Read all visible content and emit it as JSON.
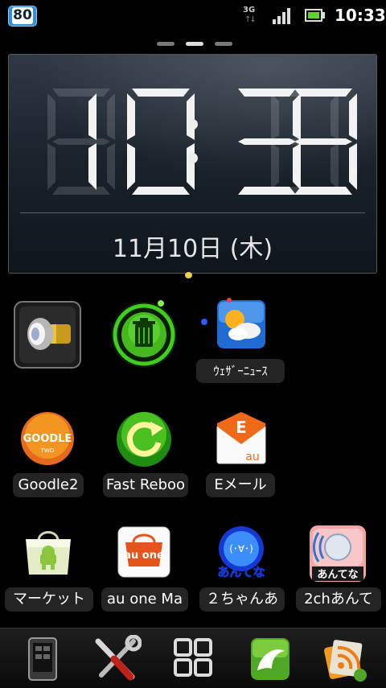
{
  "status_bar": {
    "notification_badge": "80",
    "network": "3G",
    "time": "10:33",
    "signal_bars": 4,
    "battery_level": 0.8,
    "battery_color": "#5ed52a"
  },
  "home": {
    "page_count": 3,
    "active_page": 2
  },
  "clock_widget": {
    "digits": [
      "1",
      "0",
      "3",
      "3"
    ],
    "date": "11月10日 (木)"
  },
  "apps": [
    {
      "name": "flashlight",
      "label": "",
      "icon": "flashlight-icon"
    },
    {
      "name": "task-killer",
      "label": "",
      "icon": "trash-can-icon"
    },
    {
      "name": "weather-news",
      "label": "ｳｪｻﾞｰﾆｭｰｽ",
      "icon": "weather-icon"
    },
    {
      "name": "goodle2",
      "label": "Goodle2",
      "icon": "goodle-logo-icon"
    },
    {
      "name": "fast-reboot",
      "label": "Fast Reboo",
      "icon": "refresh-icon"
    },
    {
      "name": "e-mail",
      "label": "Eメール",
      "icon": "email-icon"
    },
    {
      "name": "market",
      "label": "マーケット",
      "icon": "market-bag-icon"
    },
    {
      "name": "au-one-market",
      "label": "au one Ma",
      "icon": "au-one-icon"
    },
    {
      "name": "2ch-anntena",
      "label": "２ちゃんあ",
      "icon": "anntena-icon"
    },
    {
      "name": "2ch-anntena-2",
      "label": "2chあんて",
      "icon": "anntena-red-icon"
    }
  ],
  "icon_text": {
    "goodle": "GOODLE",
    "goodle_sub": "TWO",
    "email_letter": "E",
    "email_sub": "au",
    "au_one": "au one",
    "anntena_face": "(･∀･)",
    "anntena_label": "あんてな"
  },
  "dock": [
    {
      "name": "phone",
      "icon": "phone-device-icon"
    },
    {
      "name": "settings",
      "icon": "tools-icon"
    },
    {
      "name": "app-drawer",
      "icon": "grid-icon"
    },
    {
      "name": "dolphin-browser",
      "icon": "dolphin-icon"
    },
    {
      "name": "rss-reader",
      "icon": "rss-icon"
    }
  ]
}
